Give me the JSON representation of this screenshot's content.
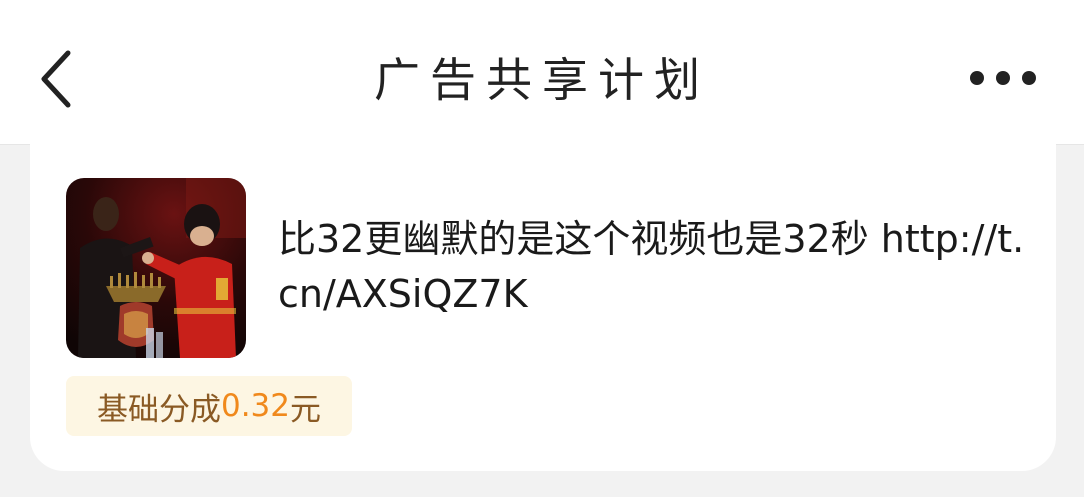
{
  "header": {
    "title": "广告共享计划",
    "back_icon": "chevron-left-icon",
    "more_icon": "more-horizontal-icon"
  },
  "post": {
    "text": "比32更幽默的是这个视频也是32秒 http://t.cn/AXSiQZ7K",
    "thumbnail_icon": "video-thumbnail"
  },
  "earnings": {
    "label": "基础分成",
    "amount": "0.32",
    "unit": "元"
  },
  "colors": {
    "background": "#f2f2f2",
    "card": "#ffffff",
    "badge_bg": "#fdf6e3",
    "badge_label": "#8a5a24",
    "badge_amount": "#f0891c"
  }
}
